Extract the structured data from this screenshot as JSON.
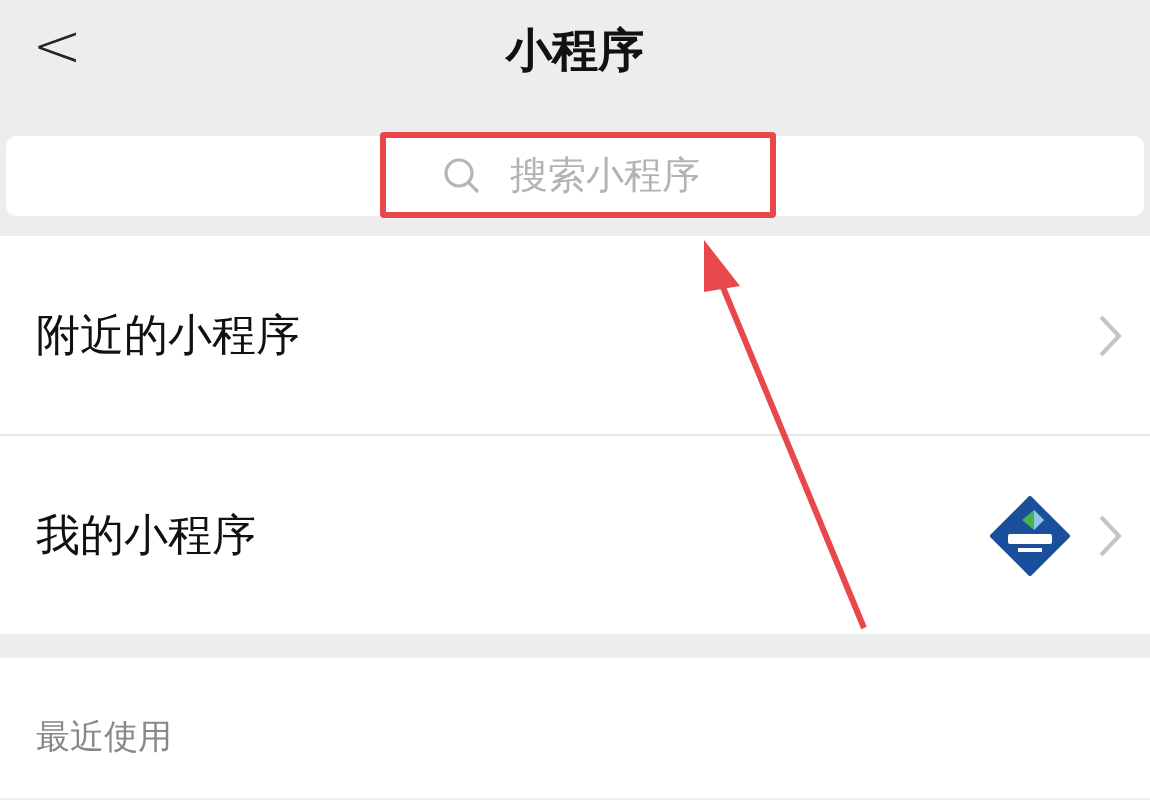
{
  "header": {
    "back": "<",
    "title": "小程序"
  },
  "search": {
    "placeholder": "搜索小程序"
  },
  "menu": [
    {
      "label": "附近的小程序",
      "kind": "plain"
    },
    {
      "label": "我的小程序",
      "kind": "logo"
    }
  ],
  "recent": {
    "heading": "最近使用"
  }
}
